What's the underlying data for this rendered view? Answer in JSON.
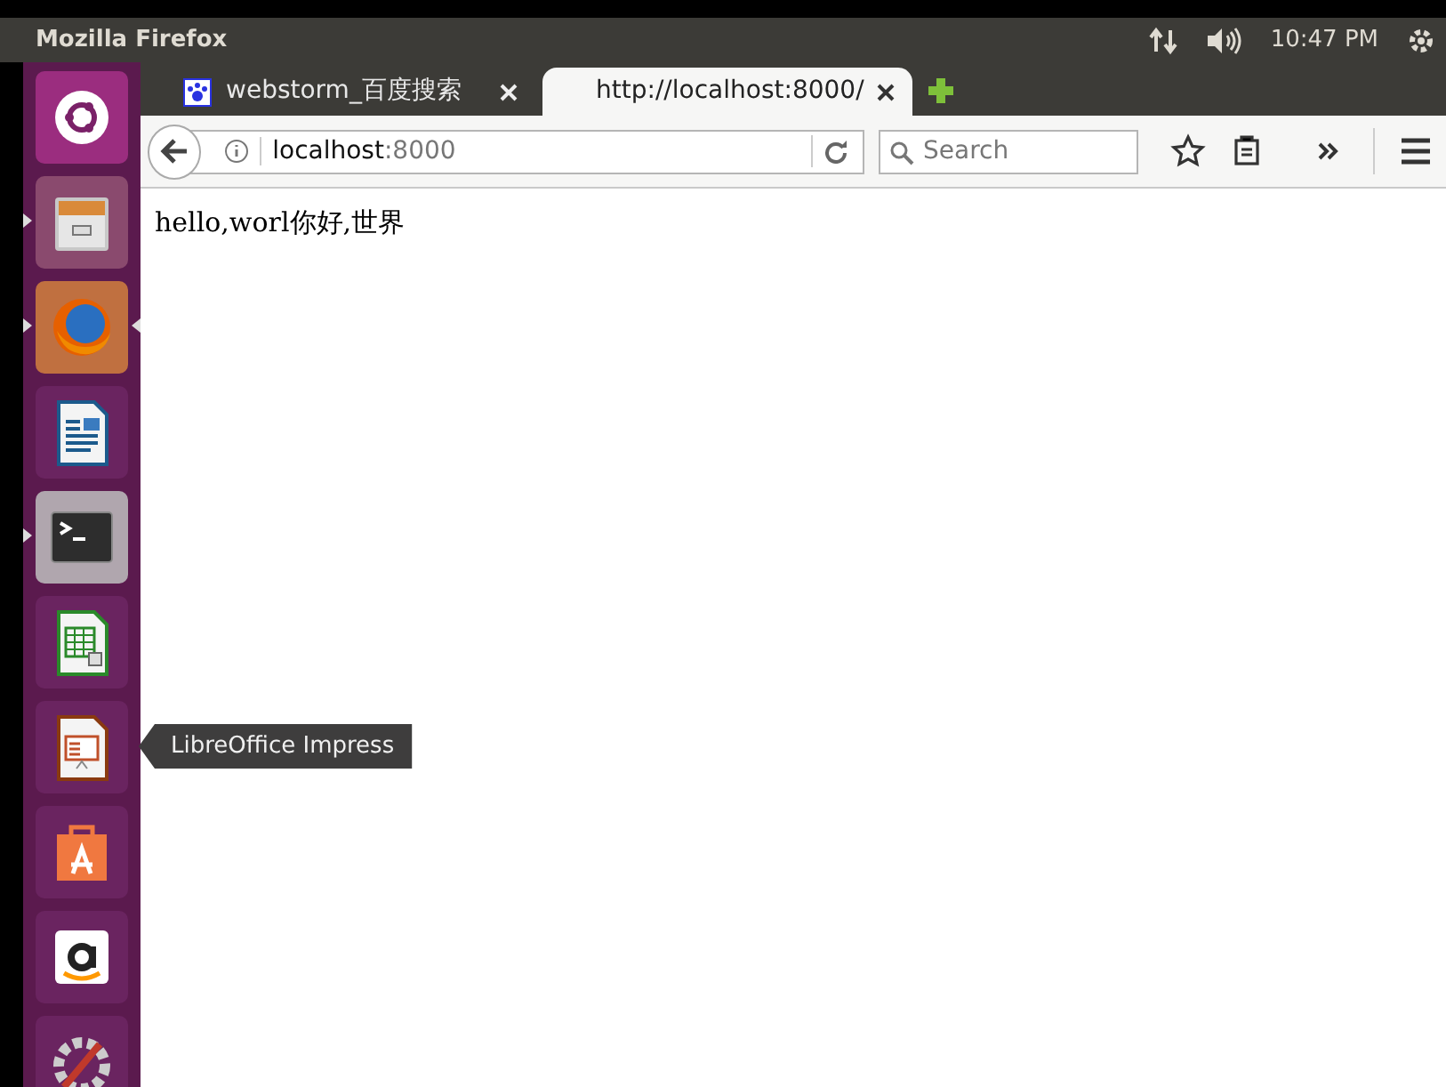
{
  "top_bar": {
    "title": "Mozilla Firefox",
    "clock": "10:47 PM"
  },
  "launcher": [
    {
      "kind": "dash",
      "running": false,
      "focused": false
    },
    {
      "kind": "files",
      "running": true,
      "focused": false
    },
    {
      "kind": "firefox",
      "running": true,
      "focused": true
    },
    {
      "kind": "writer",
      "running": false,
      "focused": false
    },
    {
      "kind": "terminal",
      "running": true,
      "focused": false
    },
    {
      "kind": "calc",
      "running": false,
      "focused": false
    },
    {
      "kind": "impress",
      "running": false,
      "focused": false,
      "tooltip": "LibreOffice Impress"
    },
    {
      "kind": "store",
      "running": false,
      "focused": false
    },
    {
      "kind": "amazon",
      "running": false,
      "focused": false
    },
    {
      "kind": "settings",
      "running": false,
      "focused": false
    }
  ],
  "tabs": [
    {
      "title": "webstorm_百度搜索",
      "selected": false
    },
    {
      "title": "http://localhost:8000/",
      "selected": true
    }
  ],
  "address": {
    "host": "localhost",
    "port": ":8000"
  },
  "search": {
    "placeholder": "Search"
  },
  "page": {
    "text": "hello,worl你好,世界"
  }
}
